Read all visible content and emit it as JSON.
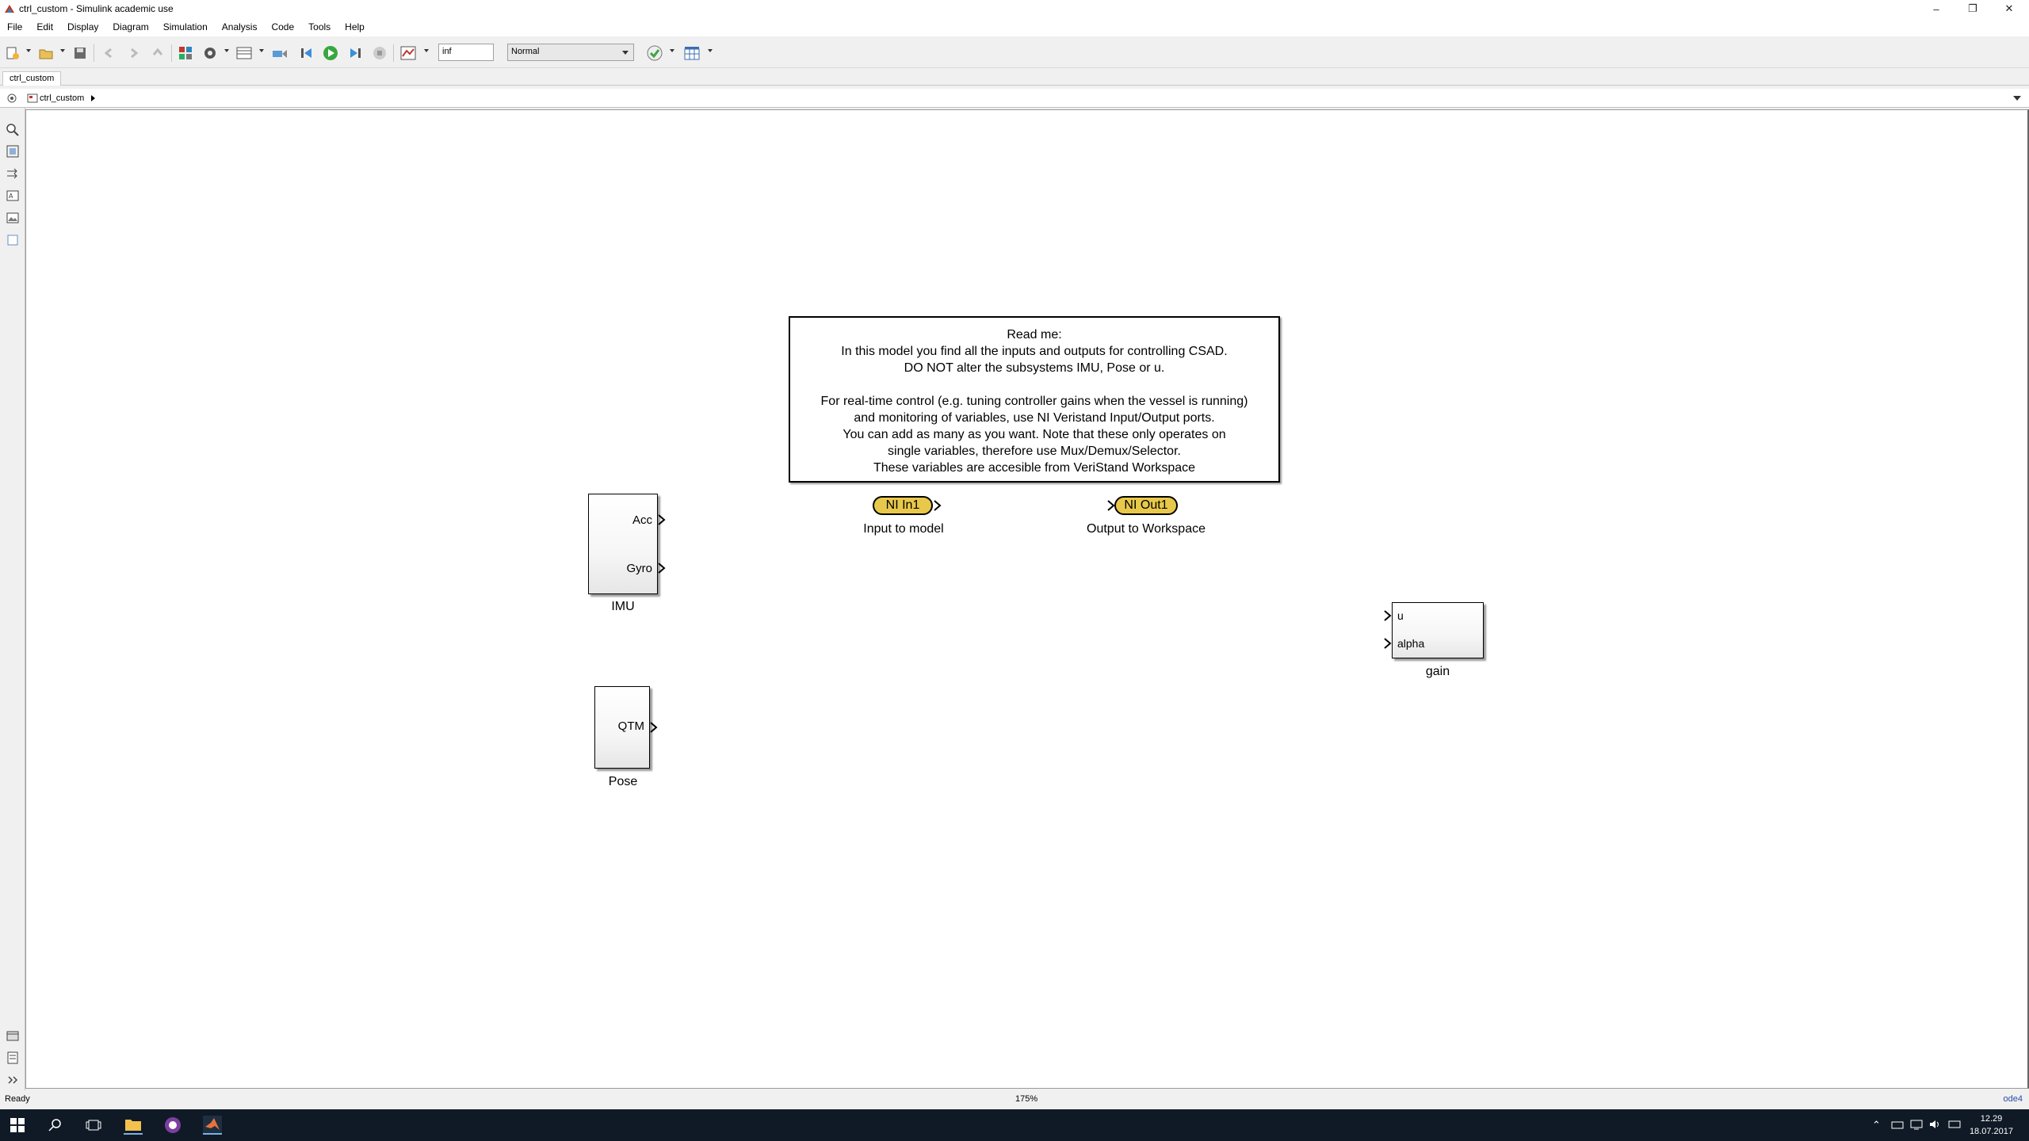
{
  "window": {
    "title": "ctrl_custom - Simulink academic use",
    "minimize": "–",
    "restore": "❐",
    "close": "✕"
  },
  "menu": [
    "File",
    "Edit",
    "Display",
    "Diagram",
    "Simulation",
    "Analysis",
    "Code",
    "Tools",
    "Help"
  ],
  "toolbar": {
    "stop_time": "inf",
    "sim_mode": "Normal"
  },
  "tab": {
    "label": "ctrl_custom"
  },
  "address": {
    "path": "ctrl_custom"
  },
  "diagram": {
    "note_lines": [
      "Read me:",
      "In this model you find all the inputs and outputs for controlling CSAD.",
      "DO NOT alter the subsystems IMU, Pose or u.",
      "",
      "For real-time control (e.g. tuning controller gains when the vessel is running)",
      "and monitoring of variables, use NI Veristand Input/Output ports.",
      "You can add as many as you want. Note that these only operates on",
      "single variables, therefore use Mux/Demux/Selector.",
      "These variables are accesible from VeriStand Workspace"
    ],
    "imu": {
      "name": "IMU",
      "ports": [
        "Acc",
        "Gyro"
      ]
    },
    "pose": {
      "name": "Pose",
      "ports": [
        "QTM"
      ]
    },
    "gain": {
      "name": "gain",
      "ports": [
        "u",
        "alpha"
      ]
    },
    "ni_in": {
      "label": "NI In1",
      "caption": "Input to model"
    },
    "ni_out": {
      "label": "NI Out1",
      "caption": "Output to Workspace"
    }
  },
  "status": {
    "state": "Ready",
    "zoom": "175%",
    "solver": "ode4"
  },
  "clock": {
    "time": "12.29",
    "date": "18.07.2017"
  },
  "colors": {
    "ni_port": "#e8c84a",
    "taskbar": "#0f1a26",
    "solver_link": "#2a4aa8"
  }
}
